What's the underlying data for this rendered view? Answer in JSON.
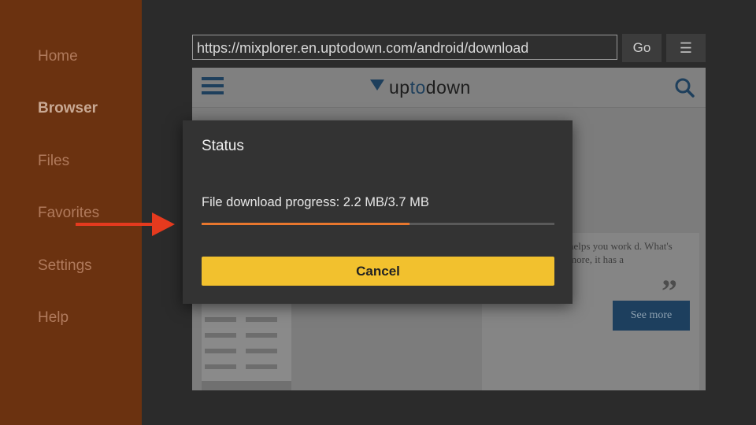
{
  "sidebar": {
    "items": [
      {
        "label": "Home"
      },
      {
        "label": "Browser"
      },
      {
        "label": "Files"
      },
      {
        "label": "Favorites"
      },
      {
        "label": "Settings"
      },
      {
        "label": "Help"
      }
    ],
    "active": "Browser"
  },
  "toolbar": {
    "url": "https://mixplorer.en.uptodown.com/android/download",
    "go_label": "Go",
    "menu_icon": "menu-icon"
  },
  "website": {
    "logo_up": "up",
    "logo_to": "to",
    "logo_down": "down",
    "card_text": "helps you work d. What's more, it has a",
    "see_more_label": "See more"
  },
  "dialog": {
    "title": "Status",
    "progress_text": "File download progress: 2.2 MB/3.7 MB",
    "progress_fraction": 0.59,
    "cancel_label": "Cancel"
  },
  "colors": {
    "sidebar_bg": "#6b3210",
    "progress": "#e8772e",
    "cancel_button": "#f2c12e",
    "arrow": "#e53a1e"
  }
}
